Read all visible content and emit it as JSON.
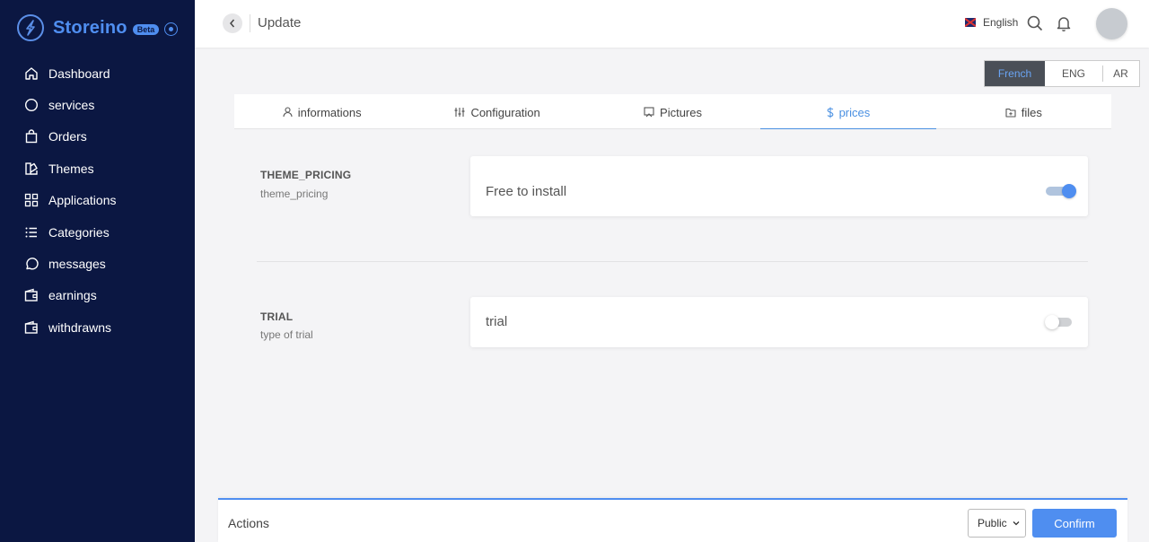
{
  "brand": {
    "name": "Storeino",
    "badge": "Beta"
  },
  "sidebar": {
    "items": [
      {
        "label": "Dashboard",
        "icon": "home-icon"
      },
      {
        "label": "services",
        "icon": "circle-icon"
      },
      {
        "label": "Orders",
        "icon": "shopping-bag-icon"
      },
      {
        "label": "Themes",
        "icon": "palette-icon"
      },
      {
        "label": "Applications",
        "icon": "grid-icon"
      },
      {
        "label": "Categories",
        "icon": "list-icon"
      },
      {
        "label": "messages",
        "icon": "message-circle-icon"
      },
      {
        "label": "earnings",
        "icon": "wallet-icon"
      },
      {
        "label": "withdrawns",
        "icon": "wallet-icon"
      }
    ]
  },
  "header": {
    "title": "Update",
    "language": "English"
  },
  "lang_tabs": {
    "items": [
      "French",
      "ENG",
      "AR"
    ],
    "active": "French"
  },
  "tabs": {
    "items": [
      {
        "label": "informations",
        "icon": "user-icon"
      },
      {
        "label": "Configuration",
        "icon": "sliders-icon"
      },
      {
        "label": "Pictures",
        "icon": "image-icon"
      },
      {
        "label": "prices",
        "icon": "dollar-icon"
      },
      {
        "label": "files",
        "icon": "folder-icon"
      }
    ],
    "active": "prices"
  },
  "fields": [
    {
      "title": "THEME_PRICING",
      "subtitle": "theme_pricing",
      "label": "Free to install",
      "enabled": true
    },
    {
      "title": "TRIAL",
      "subtitle": "type of trial",
      "label": "trial",
      "enabled": false
    }
  ],
  "actions": {
    "title": "Actions",
    "visibility": "Public",
    "confirm_label": "Confirm"
  },
  "colors": {
    "sidebar_bg": "#0b1742",
    "accent": "#4f8ef0"
  }
}
